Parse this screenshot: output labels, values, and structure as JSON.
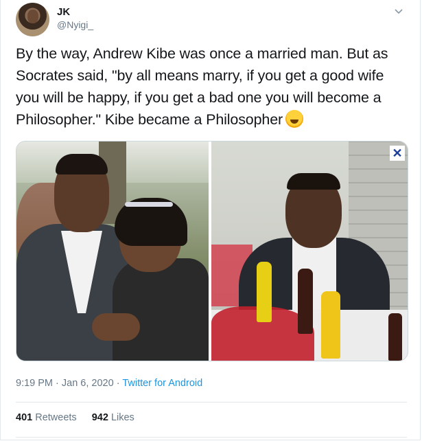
{
  "author": {
    "name": "JK",
    "handle": "@Nyigi_"
  },
  "tweet": {
    "text": "By the way, Andrew Kibe was once a married man. But as Socrates said, \"by all means marry, if you get a good wife you will be happy, if you get a bad one you will become a Philosopher.\" Kibe became a Philosopher",
    "emoji": "rolling-on-floor-laughing-emoji"
  },
  "meta": {
    "time": "9:19 PM",
    "separator": " · ",
    "date": "Jan 6, 2020",
    "source": "Twitter for Android"
  },
  "stats": {
    "retweets_count": "401",
    "retweets_label": "Retweets",
    "likes_count": "942",
    "likes_label": "Likes"
  },
  "icons": {
    "menu": "chevron-down-icon"
  },
  "colors": {
    "link": "#1b95e0",
    "muted": "#657786",
    "text": "#14171a"
  }
}
